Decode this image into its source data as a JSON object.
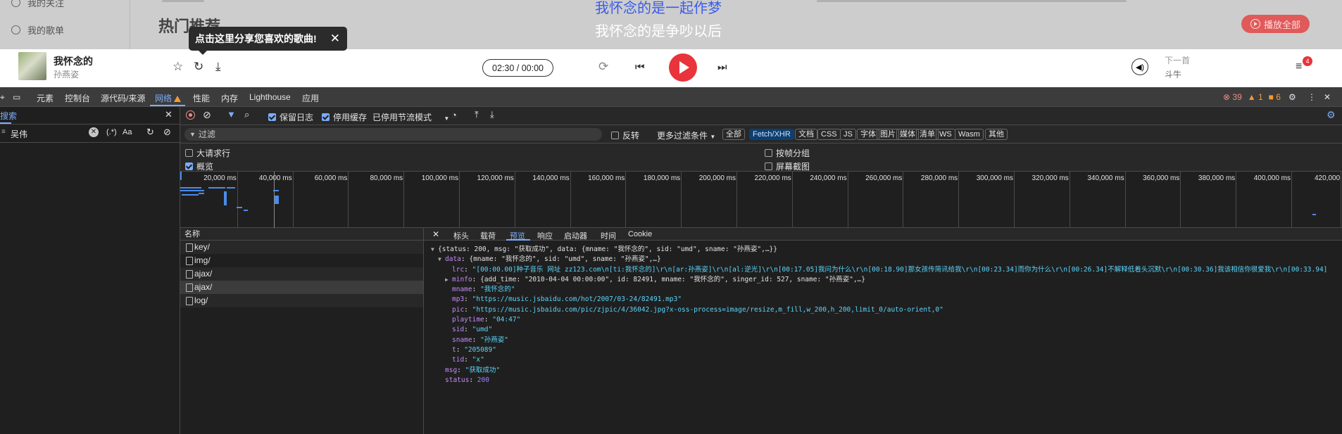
{
  "page": {
    "side_items": [
      "我的关注",
      "我的歌单"
    ],
    "section_title": "热门推荐",
    "lyric_current": "我怀念的是一起作梦",
    "lyric_next": "我怀念的是争吵以后",
    "play_all": "播放全部",
    "tooltip": "点击这里分享您喜欢的歌曲!",
    "player": {
      "song": "我怀念的",
      "singer": "孙燕姿",
      "time": "02:30 / 00:00",
      "next_label": "下一首",
      "next_song": "斗牛",
      "queue_count": "4"
    }
  },
  "devtools": {
    "tabs": [
      "元素",
      "控制台",
      "源代码/来源",
      "网络",
      "性能",
      "内存",
      "Lighthouse",
      "应用"
    ],
    "counts": {
      "errors": "39",
      "warnings": "1",
      "info": "6"
    },
    "search": {
      "label": "搜索",
      "value": "吴伟",
      "regex": "(.*)",
      "case": "Aa"
    },
    "toolbar": {
      "preserve_log": "保留日志",
      "disable_cache": "停用缓存",
      "throttle": "已停用节流模式"
    },
    "filter": {
      "placeholder": "过滤",
      "invert": "反转",
      "more": "更多过滤条件",
      "types": [
        "全部",
        "Fetch/XHR",
        "文档",
        "CSS",
        "JS",
        "字体",
        "图片",
        "媒体",
        "清单",
        "WS",
        "Wasm",
        "其他"
      ],
      "selected_type": "Fetch/XHR"
    },
    "options": {
      "big_rows": "大请求行",
      "overview": "概览",
      "group_by_frame": "按帧分组",
      "screenshots": "屏幕截图"
    },
    "timeline_ticks": [
      "20,000 ms",
      "40,000 ms",
      "60,000 ms",
      "80,000 ms",
      "100,000 ms",
      "120,000 ms",
      "140,000 ms",
      "160,000 ms",
      "180,000 ms",
      "200,000 ms",
      "220,000 ms",
      "240,000 ms",
      "260,000 ms",
      "280,000 ms",
      "300,000 ms",
      "320,000 ms",
      "340,000 ms",
      "360,000 ms",
      "380,000 ms",
      "400,000 ms",
      "420,000"
    ],
    "requests": {
      "header": "名称",
      "rows": [
        "key/",
        "img/",
        "ajax/",
        "ajax/",
        "log/"
      ],
      "selected": 3
    },
    "preview_tabs": [
      "标头",
      "载荷",
      "预览",
      "响应",
      "启动器",
      "时间",
      "Cookie"
    ],
    "preview_selected": "预览",
    "json": {
      "summary": "{status: 200, msg: \"获取成功\", data: {mname: \"我怀念的\", sid: \"umd\", sname: \"孙燕姿\",…}}",
      "data_summary": "{mname: \"我怀念的\", sid: \"umd\", sname: \"孙燕姿\",…}",
      "lrc": "\"[00:00.00]种子音乐 网址 zz123.com\\n[ti:我怀念的]\\r\\n[ar:孙燕姿]\\r\\n[al:逆光]\\r\\n[00:17.05]我问为什么\\r\\n[00:18.90]那女孩传简讯给我\\r\\n[00:23.34]而你为什么\\r\\n[00:26.34]不解释低着头沉默\\r\\n[00:30.36]我该相信你很爱我\\r\\n[00:33.94]",
      "minfo": "{add_time: \"2010-04-04 00:00:00\", id: 82491, mname: \"我怀念的\", singer_id: 527, sname: \"孙燕姿\",…}",
      "mname": "\"我怀念的\"",
      "mp3": "\"https://music.jsbaidu.com/hot/2007/03-24/82491.mp3\"",
      "pic": "\"https://music.jsbaidu.com/pic/zjpic/4/36042.jpg?x-oss-process=image/resize,m_fill,w_200,h_200,limit_0/auto-orient,0\"",
      "playtime": "\"04:47\"",
      "sid": "\"umd\"",
      "sname": "\"孙燕姿\"",
      "t": "\"205089\"",
      "tid": "\"x\"",
      "msg": "\"获取成功\"",
      "status": "200"
    }
  }
}
